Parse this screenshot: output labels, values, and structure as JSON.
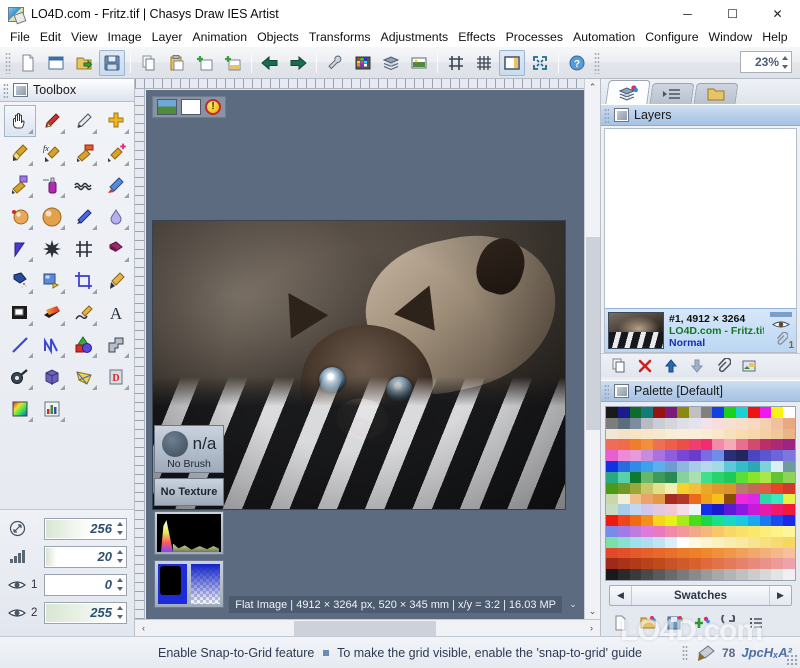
{
  "window": {
    "title": "LO4D.com - Fritz.tif | Chasys Draw IES Artist",
    "app_icon": "image-document-icon",
    "minimize": "─",
    "maximize": "☐",
    "close": "✕"
  },
  "menubar": {
    "items": [
      {
        "label": "File"
      },
      {
        "label": "Edit"
      },
      {
        "label": "View"
      },
      {
        "label": "Image"
      },
      {
        "label": "Layer"
      },
      {
        "label": "Animation"
      },
      {
        "label": "Objects"
      },
      {
        "label": "Transforms"
      },
      {
        "label": "Adjustments"
      },
      {
        "label": "Effects"
      },
      {
        "label": "Processes"
      },
      {
        "label": "Automation"
      },
      {
        "label": "Configure"
      },
      {
        "label": "Window"
      },
      {
        "label": "Help"
      }
    ]
  },
  "toolbar": {
    "buttons": [
      {
        "name": "new-file-icon",
        "title": "New"
      },
      {
        "name": "open-window-icon",
        "title": "Open"
      },
      {
        "name": "import-folder-icon",
        "title": "Import"
      },
      {
        "name": "save-icon",
        "title": "Save",
        "active": true
      },
      {
        "name": "copy-icon",
        "title": "Copy"
      },
      {
        "name": "paste-icon",
        "title": "Paste"
      },
      {
        "name": "new-layer-icon",
        "title": "New Layer"
      },
      {
        "name": "duplicate-layer-icon",
        "title": "Duplicate Layer"
      },
      {
        "name": "undo-arrow-icon",
        "title": "Undo"
      },
      {
        "name": "redo-arrow-icon",
        "title": "Redo"
      },
      {
        "name": "tools-wrench-icon",
        "title": "Tools"
      },
      {
        "name": "palette-grid-icon",
        "title": "Palette"
      },
      {
        "name": "layers-stack-icon",
        "title": "Layers"
      },
      {
        "name": "image-preview-icon",
        "title": "Preview"
      },
      {
        "name": "guides-icon",
        "title": "Guides"
      },
      {
        "name": "grid-icon",
        "title": "Grid"
      },
      {
        "name": "panels-icon",
        "title": "Panels",
        "active": true
      },
      {
        "name": "fullscreen-icon",
        "title": "Full Screen"
      },
      {
        "name": "help-icon",
        "title": "Help"
      }
    ],
    "zoom_value": "23%"
  },
  "toolbox": {
    "title": "Toolbox",
    "tools": [
      {
        "name": "hand-pan-tool",
        "selected": true
      },
      {
        "name": "pencil-tool"
      },
      {
        "name": "eyedropper-pen-tool"
      },
      {
        "name": "clone-cross-tool"
      },
      {
        "name": "paintbrush-tool"
      },
      {
        "name": "effects-brush-tool"
      },
      {
        "name": "gradient-brush-tool"
      },
      {
        "name": "healing-brush-tool"
      },
      {
        "name": "pattern-brush-tool"
      },
      {
        "name": "airbrush-tool"
      },
      {
        "name": "smudge-wave-tool"
      },
      {
        "name": "dodge-burn-tool"
      },
      {
        "name": "sphere-light-tool"
      },
      {
        "name": "sphere-render-tool"
      },
      {
        "name": "blur-pen-tool"
      },
      {
        "name": "droplet-blur-tool"
      },
      {
        "name": "sharpen-cone-tool"
      },
      {
        "name": "spark-noise-tool"
      },
      {
        "name": "hatch-pattern-tool"
      },
      {
        "name": "paint-bucket-tool"
      },
      {
        "name": "spray-paint-tool"
      },
      {
        "name": "fill-region-tool"
      },
      {
        "name": "crop-tool"
      },
      {
        "name": "color-picker-tool"
      },
      {
        "name": "select-rectangle-tool"
      },
      {
        "name": "gradient-fill-tool"
      },
      {
        "name": "freehand-lasso-tool"
      },
      {
        "name": "text-tool"
      },
      {
        "name": "line-tool"
      },
      {
        "name": "curve-tool"
      },
      {
        "name": "shapes-tool"
      },
      {
        "name": "polygon-path-tool"
      },
      {
        "name": "magic-wand-tool"
      },
      {
        "name": "cube-3d-tool"
      },
      {
        "name": "perspective-mesh-tool"
      },
      {
        "name": "document-object-tool"
      },
      {
        "name": "color-square-tool"
      },
      {
        "name": "histogram-tool"
      }
    ],
    "options": [
      {
        "icon": "size-arrows-icon",
        "label": "",
        "value": "256"
      },
      {
        "icon": "strength-bars-icon",
        "label": "",
        "value": "20"
      },
      {
        "icon": "visibility-eye-icon",
        "label": "1",
        "value": "0"
      },
      {
        "icon": "visibility-eye-icon",
        "label": "2",
        "value": "255"
      }
    ]
  },
  "canvas": {
    "mini_buttons": [
      {
        "name": "image-thumbnail-button"
      },
      {
        "name": "blank-page-button"
      },
      {
        "name": "alert-warning-button"
      }
    ],
    "overlays": {
      "brush_value": "n/a",
      "brush_caption": "No Brush",
      "texture_label": "No Texture",
      "histogram_name": "histogram-preview",
      "colors_name": "color-swatch-preview"
    },
    "status": "Flat Image | 4912 × 3264 px, 520 × 345 mm | x/y = 3:2 | 16.03 MP",
    "status_caret": "⌄",
    "scroll_left": "‹",
    "scroll_right": "›",
    "scroll_up": "⌃",
    "scroll_down": "⌄"
  },
  "right_dock": {
    "tabs": [
      {
        "name": "layers-tab",
        "icon": "layers-color-icon",
        "active": true
      },
      {
        "name": "history-tab",
        "icon": "history-list-icon",
        "active": false
      },
      {
        "name": "files-tab",
        "icon": "folder-icon",
        "active": false
      }
    ],
    "layers_panel": {
      "title": "Layers",
      "layer": {
        "dimensions": "#1, 4912 × 3264",
        "name": "LO4D.com - Fritz.tif",
        "mode": "Normal",
        "attachment_count": "1"
      },
      "toolbar": [
        {
          "name": "duplicate-layer-button"
        },
        {
          "name": "delete-layer-button"
        },
        {
          "name": "move-layer-up-button"
        },
        {
          "name": "move-layer-down-button"
        },
        {
          "name": "attach-clip-button"
        },
        {
          "name": "layer-properties-button"
        }
      ]
    },
    "palette_panel": {
      "title": "Palette [Default]",
      "swatch_label": "Swatches",
      "prev_arrow": "◀",
      "next_arrow": "▶",
      "toolbar": [
        {
          "name": "new-palette-button"
        },
        {
          "name": "open-palette-button"
        },
        {
          "name": "save-palette-button"
        },
        {
          "name": "add-color-button"
        },
        {
          "name": "reset-palette-button"
        },
        {
          "name": "palette-list-button"
        }
      ],
      "colors": [
        "#1a1a1a",
        "#1b1b8f",
        "#0f6b2c",
        "#127a7a",
        "#9b1111",
        "#7a1a7a",
        "#8a8a12",
        "#c0c0c0",
        "#808080",
        "#1340e0",
        "#19d219",
        "#19d2d2",
        "#ef1414",
        "#f018f0",
        "#f5f50f",
        "#ffffff",
        "#7d7d7d",
        "#5a6e7d",
        "#7d8da0",
        "#b8bcc2",
        "#c9cdd4",
        "#d4d6da",
        "#dedee6",
        "#e4e2ec",
        "#f3e3e8",
        "#f7dede",
        "#f7e0d2",
        "#f9ddc8",
        "#f8d8c0",
        "#f5cfae",
        "#f0c0a0",
        "#e8a882",
        "#efe7d8",
        "#f3e2c8",
        "#f6e4c4",
        "#f7e6c8",
        "#f6e8cf",
        "#f7ecd6",
        "#f8eedb",
        "#f9efd9",
        "#faecd2",
        "#fae6c8",
        "#f8e0bd",
        "#f7dcb2",
        "#f6d7ac",
        "#f4d0a4",
        "#f0c79a",
        "#e9b584",
        "#ef6c58",
        "#f06a4e",
        "#f07d2c",
        "#f28f3a",
        "#ef6f55",
        "#ee5f4a",
        "#ec4f4a",
        "#ef3f6e",
        "#f52b72",
        "#f58aa8",
        "#f6aab8",
        "#e96f8e",
        "#d24a6e",
        "#bc2f66",
        "#ab2a76",
        "#9c2485",
        "#e85fd0",
        "#ee8ad8",
        "#e79ada",
        "#c78ce0",
        "#a872e0",
        "#8f5ce0",
        "#7a46d6",
        "#6a3ccc",
        "#7a6ce4",
        "#6f8ce8",
        "#2a2f78",
        "#22265f",
        "#4a46c0",
        "#5a56cf",
        "#6a66da",
        "#7c78e0",
        "#1232e0",
        "#2a6ce0",
        "#2f8ae8",
        "#3ca0ea",
        "#5bb0ec",
        "#6f9cd0",
        "#8fb6dc",
        "#a7cce6",
        "#b7d8ec",
        "#a2dae6",
        "#5fc8d8",
        "#34bcc8",
        "#2aa8b8",
        "#7ed0da",
        "#d8f0f2",
        "#6f9aa0",
        "#2aa884",
        "#58d0a8",
        "#0f7a2f",
        "#66b86a",
        "#3f9a5a",
        "#2a8a52",
        "#86d29a",
        "#a8e0b0",
        "#3fe08a",
        "#2ad26a",
        "#1ec85a",
        "#5ade3a",
        "#8ae42a",
        "#a8e84a",
        "#62c432",
        "#8fd25a",
        "#4a9a1a",
        "#6f9a2a",
        "#9aa83a",
        "#c8c86a",
        "#e2e08a",
        "#f2f0b0",
        "#f5d22a",
        "#f2c03a",
        "#e8a82a",
        "#e09a2a",
        "#d8962a",
        "#b87a6a",
        "#c06a5a",
        "#e05a4a",
        "#e8442a",
        "#d03a2a",
        "#c8d8a8",
        "#f2eed8",
        "#f0c08a",
        "#eaa46a",
        "#e09a4a",
        "#a82a22",
        "#b03a2a",
        "#e86a1a",
        "#f0a01a",
        "#f5c01a",
        "#8a4a0a",
        "#f02ad8",
        "#d82ae8",
        "#2ad8a8",
        "#3ae8c0",
        "#e8f04a",
        "#c8dcc0",
        "#a8cce8",
        "#c0d8f0",
        "#d0c8ec",
        "#e4c8e0",
        "#f0c8d8",
        "#f4dce8",
        "#eef4fa",
        "#1230e8",
        "#1a1acc",
        "#5a1ad8",
        "#8a1ae0",
        "#c81ad8",
        "#e81aa8",
        "#f01a6a",
        "#f01a3a",
        "#ee1a12",
        "#f0441a",
        "#f06a12",
        "#f2901a",
        "#f5d61a",
        "#e8f01a",
        "#a8ea1a",
        "#4ade1a",
        "#1ad84a",
        "#1ae08a",
        "#1ad8c0",
        "#1ac8e0",
        "#1aa8ee",
        "#1a78f0",
        "#1a4af0",
        "#1a2ae8",
        "#7a8ae8",
        "#a07ae8",
        "#c07ae0",
        "#e07ad8",
        "#ea7ac0",
        "#f08aa8",
        "#f29a9a",
        "#f4a88a",
        "#f6b87a",
        "#f7c86a",
        "#f8d66a",
        "#f9e06a",
        "#fae86a",
        "#fbee7a",
        "#fcf28a",
        "#fdf59a",
        "#7ae0a8",
        "#8ae0d0",
        "#a0e0e8",
        "#b0dcf0",
        "#c0e4f4",
        "#d8eef8",
        "#ffffff",
        "#fdf8e0",
        "#fcf4d0",
        "#fbf0c0",
        "#faecb0",
        "#f9e8a0",
        "#f8e490",
        "#f7e080",
        "#f6dc70",
        "#f5d860",
        "#e04a2a",
        "#e2502a",
        "#e4582a",
        "#e6602a",
        "#e8682a",
        "#ea702a",
        "#ec782a",
        "#ee802a",
        "#ef882a",
        "#f0903a",
        "#f0984a",
        "#f1a05a",
        "#f2a86a",
        "#f3b07a",
        "#f4b88a",
        "#f5c09a",
        "#a02a1a",
        "#a8321a",
        "#b03a1a",
        "#b8421a",
        "#c04a1a",
        "#c8522a",
        "#d05a2a",
        "#d8622a",
        "#e06a3a",
        "#e2724a",
        "#e47a5a",
        "#e6826a",
        "#e88a7a",
        "#ea928a",
        "#ec9a9a",
        "#eea2aa",
        "#1a1a1a",
        "#2a2a2a",
        "#3a3a3a",
        "#4a4a4a",
        "#5a5a5a",
        "#6a6a6a",
        "#7a7a7a",
        "#8a8a8a",
        "#9a9a9a",
        "#a8a8a8",
        "#b4b4b4",
        "#c0c0c0",
        "#cccccc",
        "#d8d8d8",
        "#e4e4e4",
        "#f0f0f0"
      ]
    }
  },
  "statusbar": {
    "hint_primary": "Enable Snap-to-Grid feature",
    "hint_secondary": "To make the grid visible, enable the 'snap-to-grid' guide",
    "right_number": "78",
    "right_logo": "JpcHₓA²"
  },
  "watermark": {
    "text": "LO4D.com"
  }
}
